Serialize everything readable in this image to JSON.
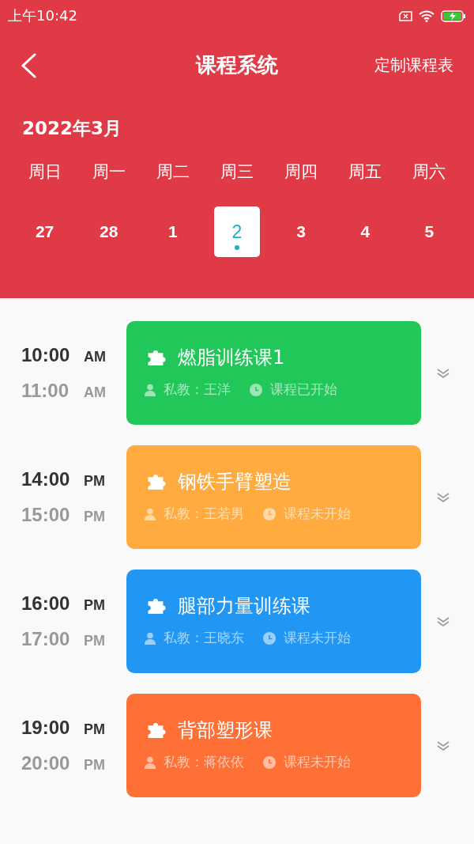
{
  "status_bar": {
    "time": "上午10:42"
  },
  "header": {
    "title": "课程系统",
    "action": "定制课程表"
  },
  "calendar": {
    "month": "2022年3月",
    "weekdays": [
      "周日",
      "周一",
      "周二",
      "周三",
      "周四",
      "周五",
      "周六"
    ],
    "dates": [
      {
        "label": "27",
        "selected": false
      },
      {
        "label": "28",
        "selected": false
      },
      {
        "label": "1",
        "selected": false
      },
      {
        "label": "2",
        "selected": true
      },
      {
        "label": "3",
        "selected": false
      },
      {
        "label": "4",
        "selected": false
      },
      {
        "label": "5",
        "selected": false
      }
    ]
  },
  "courses": [
    {
      "start": "10:00",
      "start_period": "AM",
      "end": "11:00",
      "end_period": "AM",
      "name": "燃脂训练课1",
      "coach": "私教：王洋",
      "status": "课程已开始",
      "color": "#22c75a"
    },
    {
      "start": "14:00",
      "start_period": "PM",
      "end": "15:00",
      "end_period": "PM",
      "name": "钢铁手臂塑造",
      "coach": "私教：王若男",
      "status": "课程未开始",
      "color": "#ffab40"
    },
    {
      "start": "16:00",
      "start_period": "PM",
      "end": "17:00",
      "end_period": "PM",
      "name": "腿部力量训练课",
      "coach": "私教：王晓东",
      "status": "课程未开始",
      "color": "#2196f3"
    },
    {
      "start": "19:00",
      "start_period": "PM",
      "end": "20:00",
      "end_period": "PM",
      "name": "背部塑形课",
      "coach": "私教：蒋依依",
      "status": "课程未开始",
      "color": "#ff7036"
    }
  ]
}
